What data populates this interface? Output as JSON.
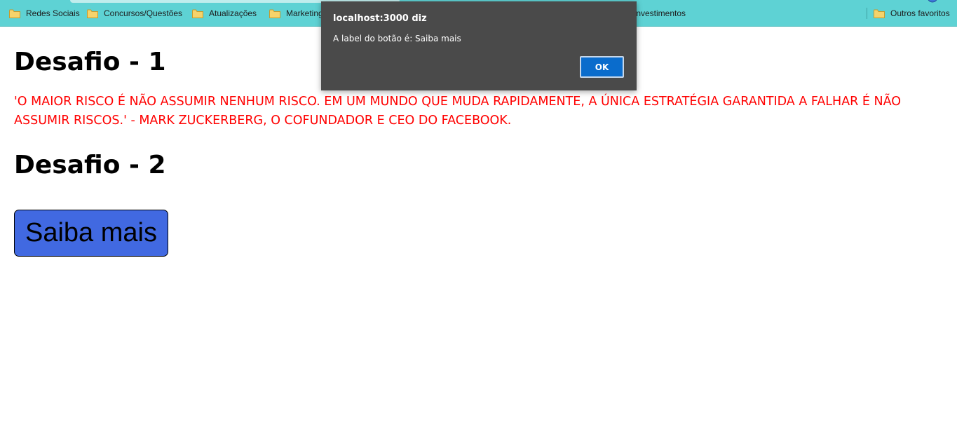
{
  "bookmarks_bar": {
    "items": [
      {
        "label": "Redes Sociais"
      },
      {
        "label": "Concursos/Questões"
      },
      {
        "label": "Atualizações"
      },
      {
        "label": "Marketing"
      },
      {
        "label": "Investimentos"
      }
    ],
    "other_favorites": "Outros favoritos",
    "background_color": "#5ed2d4"
  },
  "page": {
    "heading_1": "Desafio - 1",
    "quote": "'O MAIOR RISCO É NÃO ASSUMIR NENHUM RISCO. EM UM MUNDO QUE MUDA RAPIDAMENTE, A ÚNICA ESTRATÉGIA GARANTIDA A FALHAR É NÃO ASSUMIR RISCOS.' - MARK ZUCKERBERG, O COFUNDADOR E CEO DO FACEBOOK.",
    "quote_color": "#ff0000",
    "heading_2": "Desafio - 2",
    "button_label": "Saiba mais",
    "button_color": "#4169e1"
  },
  "alert_dialog": {
    "title": "localhost:3000 diz",
    "message": "A label do botão é: Saiba mais",
    "ok_label": "OK",
    "ok_color": "#0a6ccc"
  }
}
